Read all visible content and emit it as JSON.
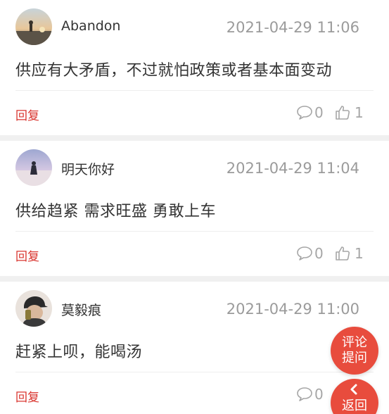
{
  "comments": [
    {
      "username": "Abandon",
      "timestamp": "2021-04-29 11:06",
      "content": "供应有大矛盾，不过就怕政策或者基本面变动",
      "reply_label": "回复",
      "comment_count": "0",
      "like_count": "1",
      "avatar": "avatar-sunset-figure"
    },
    {
      "username": "明天你好",
      "timestamp": "2021-04-29 11:04",
      "content": "供给趋紧 需求旺盛 勇敢上车",
      "reply_label": "回复",
      "comment_count": "0",
      "like_count": "1",
      "avatar": "avatar-beach-figure"
    },
    {
      "username": "莫毅痕",
      "timestamp": "2021-04-29 11:00",
      "content": "赶紧上呗，能喝汤",
      "reply_label": "回复",
      "comment_count": "0",
      "like_count": "",
      "avatar": "avatar-person-cap"
    }
  ],
  "fab_comment": {
    "line1": "评论",
    "line2": "提问"
  },
  "fab_back": {
    "label": "返回"
  },
  "colors": {
    "accent": "#d9352f",
    "fab": "#e84c3d",
    "muted": "#9b9b9b",
    "separator": "#f0f0f0"
  },
  "icons": {
    "comment": "speech-bubble-icon",
    "like": "thumbs-up-icon",
    "back": "chevron-left-icon"
  }
}
